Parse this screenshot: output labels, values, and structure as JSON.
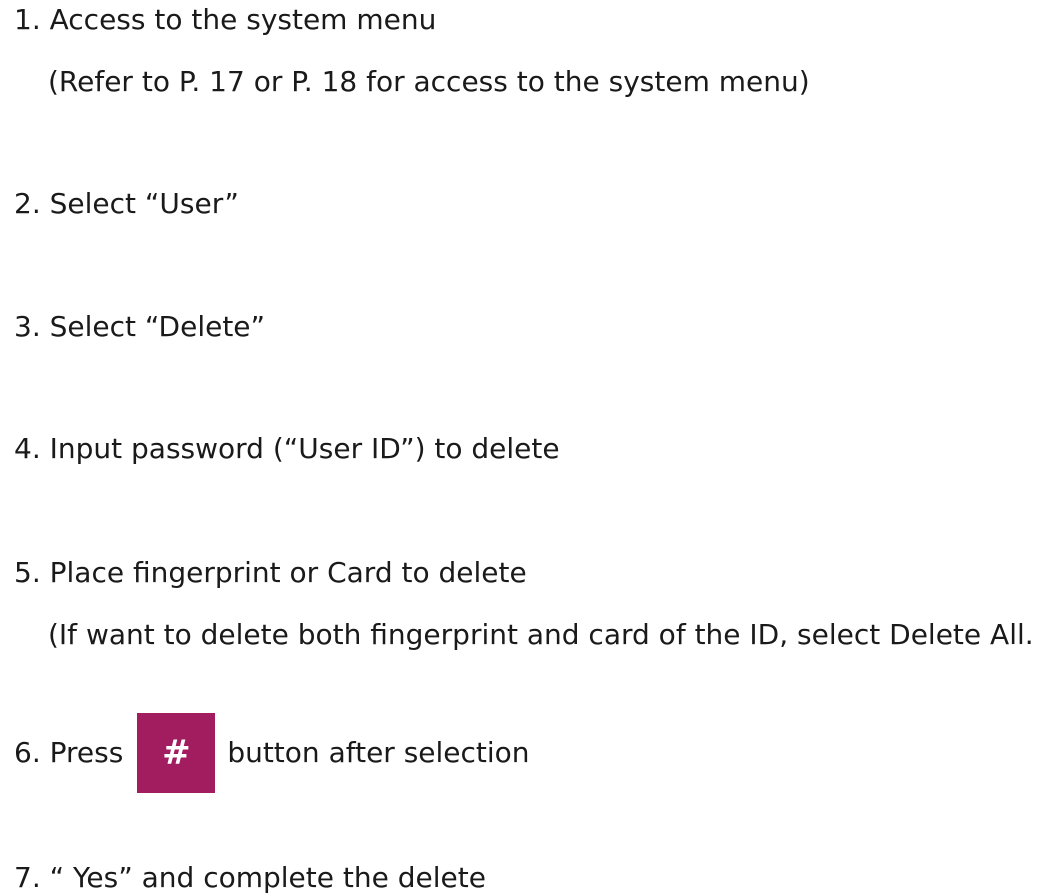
{
  "steps": [
    {
      "text": "1. Access to the system menu",
      "note": "(Refer to P. 17 or P. 18 for access to the system menu)"
    },
    {
      "text": "2. Select “User”"
    },
    {
      "text": "3. Select “Delete”"
    },
    {
      "text": "4. Input password (“User ID”) to delete"
    },
    {
      "text": "5. Place fingerprint or Card to delete",
      "note": "(If want to delete both fingerprint and card of the ID, select Delete All."
    },
    {
      "prefix": "6. Press",
      "key": "#",
      "suffix": "button after selection"
    },
    {
      "text": "7. “ Yes” and complete the delete"
    }
  ],
  "colors": {
    "key_background": "#a21d5f",
    "key_text": "#ffffff",
    "text": "#1a1a1a"
  }
}
